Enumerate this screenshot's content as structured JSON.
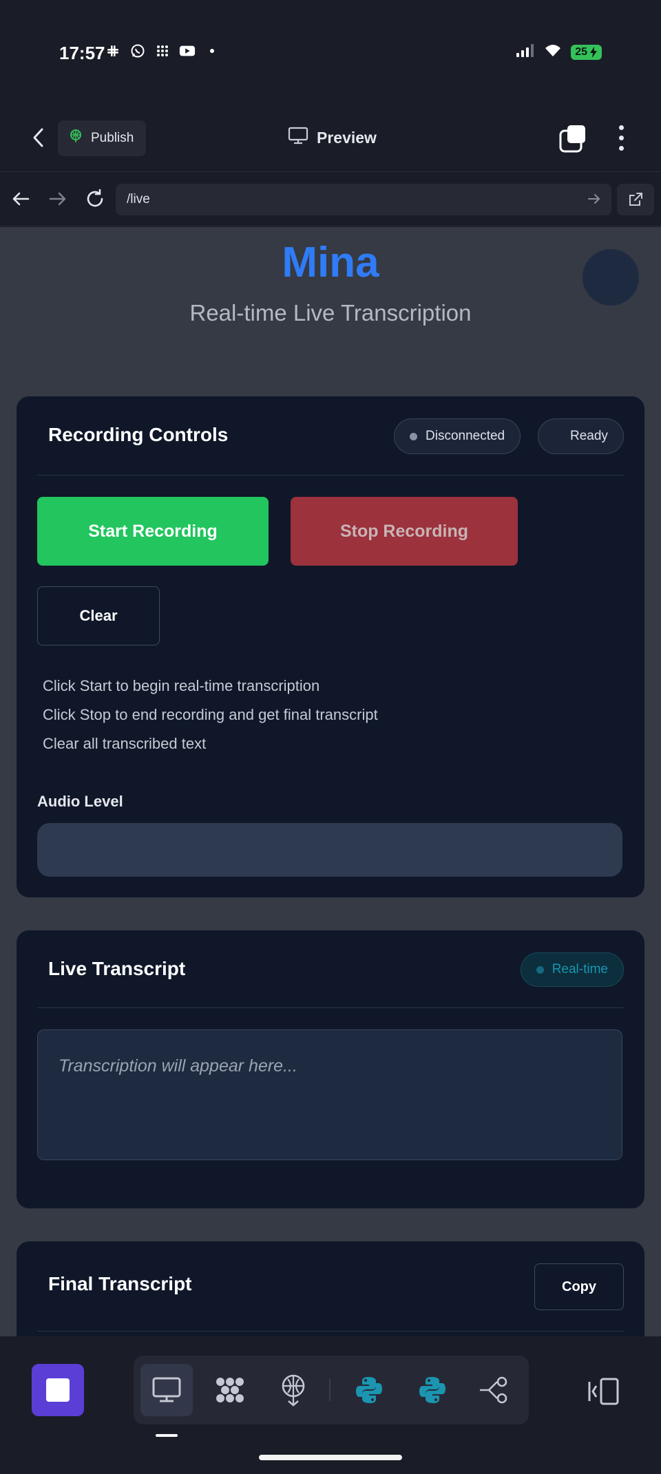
{
  "status_bar": {
    "time": "17:57",
    "battery": "25",
    "icons": [
      "slack-icon",
      "whatsapp-icon",
      "grid-app-icon",
      "youtube-icon",
      "dot-icon",
      "signal-icon",
      "wifi-icon",
      "battery-icon"
    ]
  },
  "header": {
    "publish_label": "Publish",
    "preview_label": "Preview"
  },
  "url_bar": {
    "url": "/live"
  },
  "page": {
    "brand": "Mina",
    "subtitle": "Real-time Live Transcription"
  },
  "recording_controls": {
    "title": "Recording Controls",
    "connection_status": "Disconnected",
    "state_status": "Ready",
    "start_label": "Start Recording",
    "stop_label": "Stop Recording",
    "clear_label": "Clear",
    "hints": [
      "Click Start to begin real-time transcription",
      "Click Stop to end recording and get final transcript",
      "Clear all transcribed text"
    ],
    "audio_level_label": "Audio Level",
    "audio_level": 0
  },
  "live_transcript": {
    "title": "Live Transcript",
    "badge": "Real-time",
    "placeholder": "Transcription will appear here..."
  },
  "final_transcript": {
    "title": "Final Transcript",
    "copy_label": "Copy"
  },
  "toolbar": {
    "tools": [
      "desktop-preview-icon",
      "extensions-icon",
      "deploy-icon",
      "python-icon",
      "python-icon",
      "git-branch-icon"
    ],
    "colors": {
      "accent": "#5b3ed6",
      "python": "#1b95b0"
    }
  },
  "colors": {
    "brand": "#2f7cf6",
    "start": "#22c55e",
    "stop": "#9b323c",
    "card": "#0f1729"
  }
}
